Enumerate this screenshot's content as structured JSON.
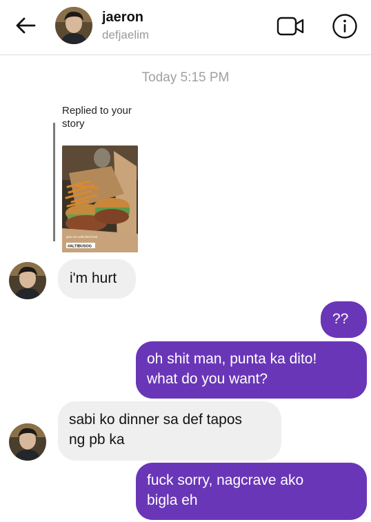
{
  "header": {
    "name": "jaeron",
    "username": "defjaelim",
    "icons": {
      "back": "arrow-left-icon",
      "video": "video-camera-icon",
      "info": "info-circle-icon"
    }
  },
  "thread": {
    "timestamp": "Today 5:15 PM",
    "story_reply_label": "Replied to your story",
    "story_thumb_text_1": "give me unlimited food",
    "story_thumb_text_2": "#ALTIBUSOG"
  },
  "messages": [
    {
      "from": "them",
      "text": "i'm hurt"
    },
    {
      "from": "me",
      "text": "??"
    },
    {
      "from": "me",
      "lines": [
        "oh shit man, punta ka dito!",
        "what do you want?"
      ]
    },
    {
      "from": "them",
      "lines": [
        "sabi ko dinner sa def tapos",
        "ng pb ka"
      ]
    },
    {
      "from": "me",
      "lines": [
        "fuck sorry, nagcrave ako",
        "bigla eh"
      ]
    }
  ],
  "colors": {
    "outgoing_bubble": "#6a36b8",
    "incoming_bubble": "#efefef",
    "timestamp": "#a0a0a0"
  }
}
